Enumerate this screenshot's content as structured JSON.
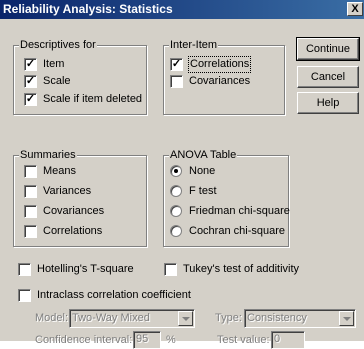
{
  "window": {
    "title": "Reliability Analysis: Statistics",
    "close_glyph": "X"
  },
  "descriptives": {
    "title": "Descriptives for",
    "items": [
      {
        "label": "Item",
        "checked": true
      },
      {
        "label": "Scale",
        "checked": true
      },
      {
        "label": "Scale if item deleted",
        "checked": true
      }
    ]
  },
  "inter_item": {
    "title": "Inter-Item",
    "items": [
      {
        "label": "Correlations",
        "checked": true
      },
      {
        "label": "Covariances",
        "checked": false
      }
    ]
  },
  "summaries": {
    "title": "Summaries",
    "items": [
      {
        "label": "Means",
        "checked": false
      },
      {
        "label": "Variances",
        "checked": false
      },
      {
        "label": "Covariances",
        "checked": false
      },
      {
        "label": "Correlations",
        "checked": false
      }
    ]
  },
  "anova": {
    "title": "ANOVA Table",
    "options": [
      {
        "label": "None",
        "selected": true
      },
      {
        "label": "F test",
        "selected": false
      },
      {
        "label": "Friedman chi-square",
        "selected": false
      },
      {
        "label": "Cochran chi-square",
        "selected": false
      }
    ]
  },
  "buttons": {
    "continue": "Continue",
    "cancel": "Cancel",
    "help": "Help"
  },
  "extra": {
    "hotelling": {
      "label": "Hotelling's T-square",
      "checked": false
    },
    "tukey": {
      "label": "Tukey's test of additivity",
      "checked": false
    },
    "intraclass": {
      "label": "Intraclass correlation coefficient",
      "checked": false
    }
  },
  "icc": {
    "model_label": "Model:",
    "model_value": "Two-Way Mixed",
    "type_label": "Type:",
    "type_value": "Consistency",
    "ci_label": "Confidence interval:",
    "ci_value": "95",
    "ci_unit": "%",
    "test_label": "Test value:",
    "test_value": "0"
  },
  "colors": {
    "face": "#d4d0c8",
    "title_start": "#0a246a",
    "title_end": "#3a6ea5",
    "disabled_text": "#808080"
  }
}
